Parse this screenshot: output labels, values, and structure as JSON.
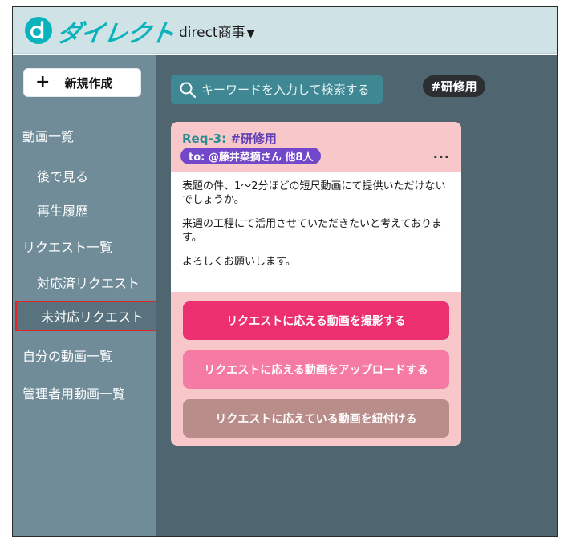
{
  "header": {
    "logo_text": "ダイレクト",
    "company": "direct商事",
    "caret": "▼"
  },
  "sidebar": {
    "new_button": {
      "plus": "+",
      "label": "新規作成"
    },
    "items": [
      {
        "label": "動画一覧",
        "level": "top"
      },
      {
        "label": "後で見る",
        "level": "sub"
      },
      {
        "label": "再生履歴",
        "level": "sub"
      },
      {
        "label": "リクエスト一覧",
        "level": "top"
      },
      {
        "label": "対応済リクエスト",
        "level": "sub"
      },
      {
        "label": "未対応リクエスト",
        "level": "sub",
        "selected": true
      },
      {
        "label": "自分の動画一覧",
        "level": "top"
      },
      {
        "label": "管理者用動画一覧",
        "level": "top"
      }
    ]
  },
  "main": {
    "search": {
      "placeholder": "キーワードを入力して検索する"
    },
    "tag_chip": "#研修用",
    "card": {
      "req_id": "Req-3:",
      "tag": "#研修用",
      "to": "to: @藤井菜摘さん 他8人",
      "more": "...",
      "body": [
        "表題の件、1～2分ほどの短尺動画にて提供いただけないでしょうか。",
        "来週の工程にて活用させていただきたいと考えております。",
        "よろしくお願いします。"
      ],
      "actions": [
        "リクエストに応える動画を撮影する",
        "リクエストに応える動画をアップロードする",
        "リクエストに応えている動画を紐付ける"
      ]
    }
  },
  "colors": {
    "header_bg": "#cfe2e6",
    "sidebar_bg": "#6f8c98",
    "main_bg": "#4f6670",
    "brand": "#0ab3bb",
    "primary_action": "#ec2f6f",
    "secondary_action": "#f57aa4",
    "tertiary_action": "#b98d8a",
    "selected_outline": "#e0242a"
  }
}
